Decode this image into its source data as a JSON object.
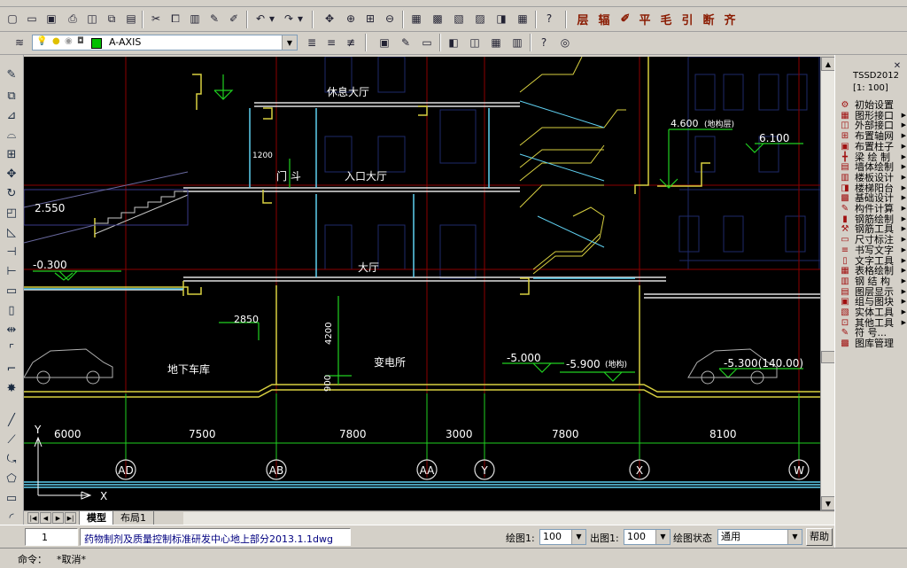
{
  "toolbar1": {
    "text_tools": [
      "层",
      "辐",
      "平",
      "毛",
      "引",
      "断",
      "齐"
    ]
  },
  "toolbar2": {
    "current_layer": "A-AXIS"
  },
  "drawing": {
    "rooms": [
      "休息大厅",
      "门 斗",
      "入口大厅",
      "大厅",
      "地下车库",
      "变电所"
    ],
    "elevations": [
      "2.550",
      "-0.300",
      "4.600",
      "(地构层)",
      "6.100",
      "-5.000",
      "-5.900",
      "(地构)",
      "-5.300(140.00)"
    ],
    "dims_vertical": [
      "1200",
      "2850",
      "4200",
      "900"
    ],
    "axis_spans": [
      "6000",
      "7500",
      "7800",
      "3000",
      "7800",
      "8100"
    ],
    "axis_labels": [
      "AD",
      "AB",
      "AA",
      "Y",
      "X",
      "W"
    ],
    "ucs": {
      "y": "Y",
      "x": "X"
    }
  },
  "layout_tabs": [
    "模型",
    "布局1"
  ],
  "status": {
    "row_number": "1",
    "filename": "药物制剂及质量控制标准研发中心地上部分2013.1.1dwg",
    "draw_scale_label": "绘图1:",
    "draw_scale_value": "100",
    "out_scale_label": "出图1:",
    "out_scale_value": "100",
    "state_label": "绘图状态",
    "state_value": "通用",
    "help_label": "帮助"
  },
  "command": {
    "prompt": "命令：",
    "text": "*取消*"
  },
  "right_panel": {
    "title": "TSSD2012",
    "scale": "[1: 100]",
    "items": [
      {
        "label": "初始设置",
        "arrow": false
      },
      {
        "label": "图形接口",
        "arrow": true
      },
      {
        "label": "外部接口",
        "arrow": true
      },
      {
        "label": "布置轴网",
        "arrow": true
      },
      {
        "label": "布置柱子",
        "arrow": true
      },
      {
        "label": "梁 绘 制",
        "arrow": true
      },
      {
        "label": "墙体绘制",
        "arrow": true
      },
      {
        "label": "楼板设计",
        "arrow": true
      },
      {
        "label": "楼梯阳台",
        "arrow": true
      },
      {
        "label": "基础设计",
        "arrow": true
      },
      {
        "label": "构件计算",
        "arrow": true
      },
      {
        "label": "钢筋绘制",
        "arrow": true
      },
      {
        "label": "钢筋工具",
        "arrow": true
      },
      {
        "label": "尺寸标注",
        "arrow": true
      },
      {
        "label": "书写文字",
        "arrow": true
      },
      {
        "label": "文字工具",
        "arrow": true
      },
      {
        "label": "表格绘制",
        "arrow": true
      },
      {
        "label": "钢 结 构",
        "arrow": true
      },
      {
        "label": "图层显示",
        "arrow": true
      },
      {
        "label": "组与图块",
        "arrow": true
      },
      {
        "label": "实体工具",
        "arrow": true
      },
      {
        "label": "其他工具",
        "arrow": true
      },
      {
        "label": "符 号...",
        "arrow": false
      },
      {
        "label": "图库管理",
        "arrow": false
      }
    ]
  }
}
